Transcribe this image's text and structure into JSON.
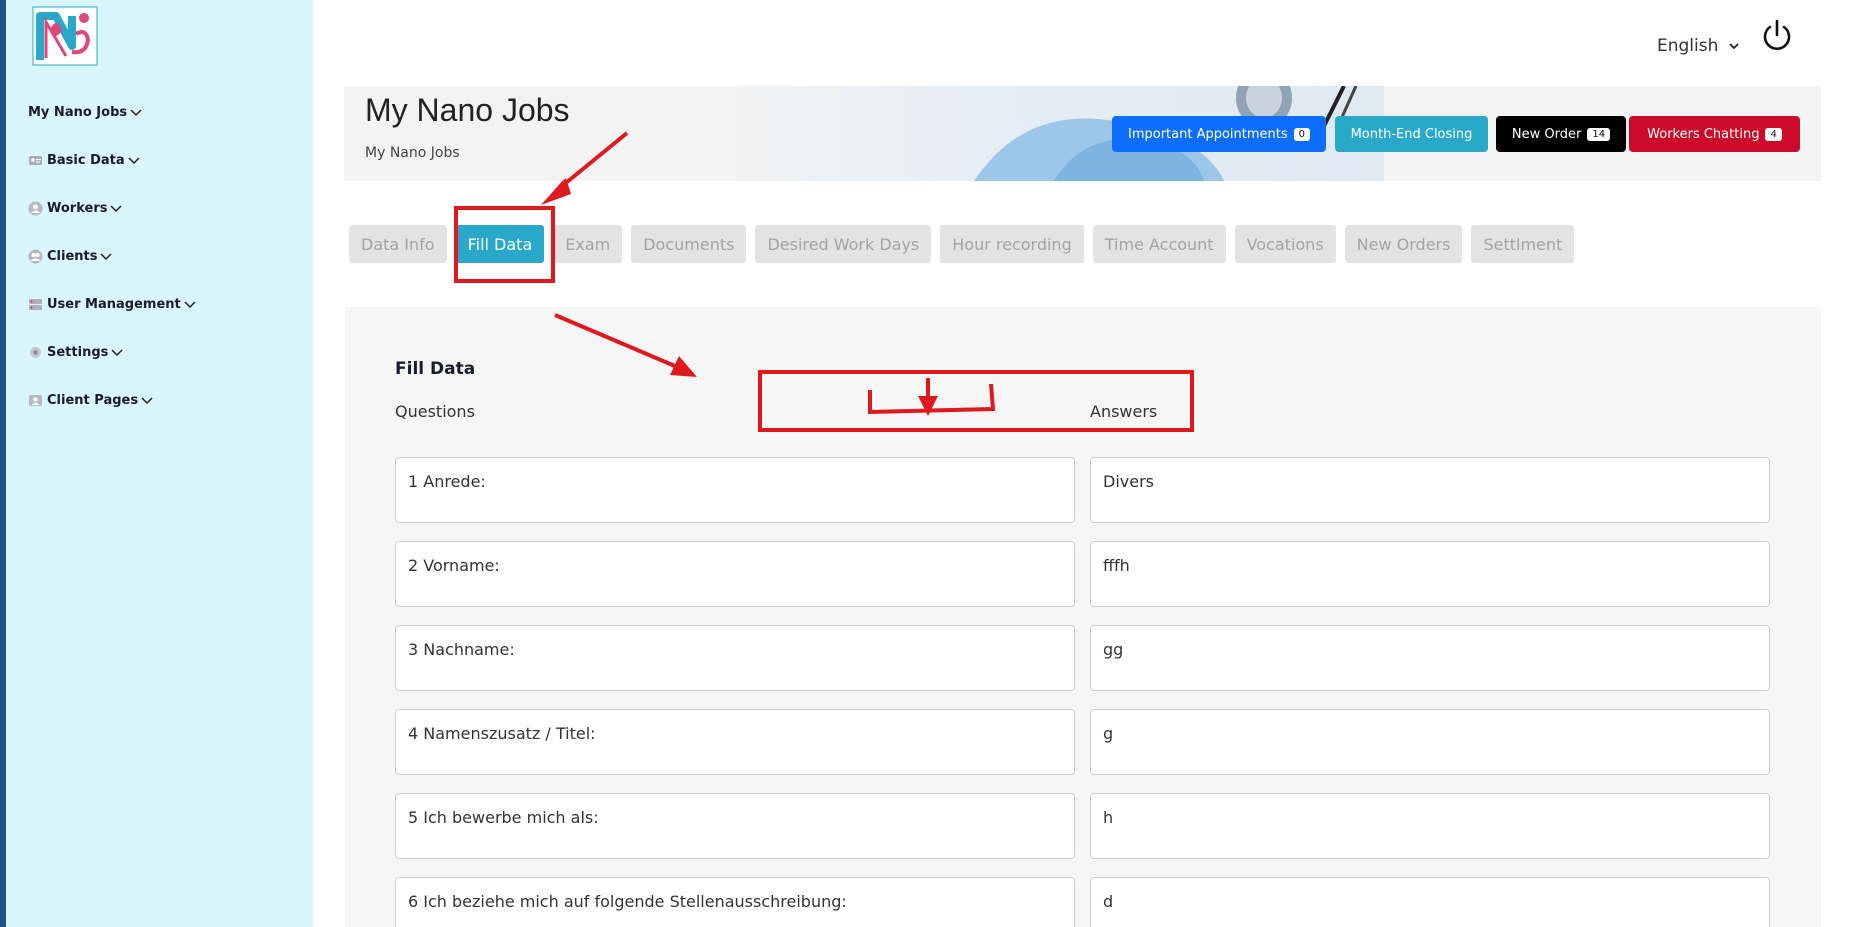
{
  "sidebar": {
    "items": [
      {
        "label": "My Nano Jobs",
        "icon": "none"
      },
      {
        "label": "Basic Data",
        "icon": "id-card-icon"
      },
      {
        "label": "Workers",
        "icon": "user-icon"
      },
      {
        "label": "Clients",
        "icon": "users-icon"
      },
      {
        "label": "User Management",
        "icon": "server-icon"
      },
      {
        "label": "Settings",
        "icon": "gear-icon"
      },
      {
        "label": "Client Pages",
        "icon": "person-badge-icon"
      }
    ]
  },
  "header": {
    "language": "English"
  },
  "banner": {
    "title": "My Nano Jobs",
    "subtitle": "My Nano Jobs",
    "buttons": [
      {
        "label": "Important Appointments",
        "badge": "0",
        "color": "#0d6efd"
      },
      {
        "label": "Month-End Closing",
        "badge": "",
        "color": "#2aa8c9"
      },
      {
        "label": "New Order",
        "badge": "14",
        "color": "#000000"
      },
      {
        "label": "Workers Chatting",
        "badge": "4",
        "color": "#cc0a2a"
      }
    ]
  },
  "tabs": [
    {
      "label": "Data Info",
      "active": false
    },
    {
      "label": "Fill Data",
      "active": true
    },
    {
      "label": "Exam",
      "active": false
    },
    {
      "label": "Documents",
      "active": false
    },
    {
      "label": "Desired Work Days",
      "active": false
    },
    {
      "label": "Hour recording",
      "active": false
    },
    {
      "label": "Time Account",
      "active": false
    },
    {
      "label": "Vocations",
      "active": false
    },
    {
      "label": "New Orders",
      "active": false
    },
    {
      "label": "Settlment",
      "active": false
    }
  ],
  "fill_data": {
    "title": "Fill Data",
    "questions_header": "Questions",
    "answers_header": "Answers",
    "rows": [
      {
        "question": "1 Anrede:",
        "answer": "Divers"
      },
      {
        "question": "2 Vorname:",
        "answer": "fffh"
      },
      {
        "question": "3 Nachname:",
        "answer": "gg"
      },
      {
        "question": "4 Namenszusatz / Titel:",
        "answer": "g"
      },
      {
        "question": "5 Ich bewerbe mich als:",
        "answer": "h"
      },
      {
        "question": "6 Ich beziehe mich auf folgende Stellenausschreibung:",
        "answer": "d"
      }
    ]
  },
  "colors": {
    "sidebar_bg": "#d8f6fc",
    "accent": "#2aa8c9",
    "annotation_red": "#e0191f"
  }
}
